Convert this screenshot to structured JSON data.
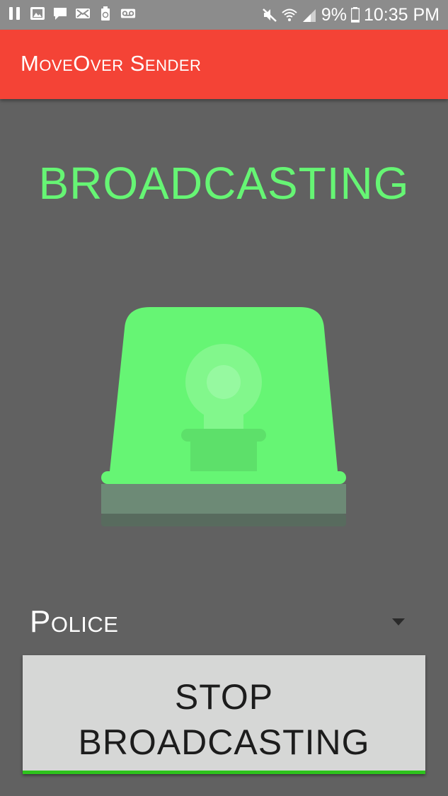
{
  "status_bar": {
    "left_icons": [
      "pause-icon",
      "image-icon",
      "chat-icon",
      "email-icon",
      "recycle-icon",
      "voicemail-icon"
    ],
    "battery_percent": "9%",
    "time": "10:35 PM"
  },
  "app_bar": {
    "title": "MoveOver Sender"
  },
  "main": {
    "status_heading": "BROADCASTING",
    "vehicle_type": {
      "selected": "Police"
    },
    "stop_button": {
      "label": "STOP BROADCASTING"
    }
  },
  "colors": {
    "app_bar": "#f44336",
    "background": "#616161",
    "accent_green": "#66f574",
    "button_bg": "#d6d7d6",
    "button_underline": "#2ec31d"
  }
}
